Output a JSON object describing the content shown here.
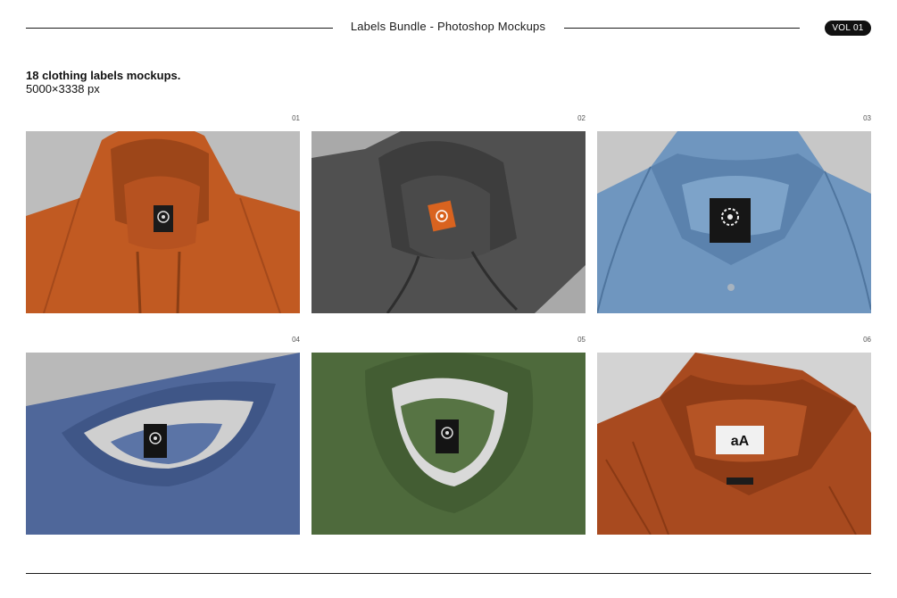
{
  "header": {
    "title": "Labels Bundle - Photoshop Mockups",
    "badge": "VOL 01"
  },
  "intro": {
    "heading": "18 clothing labels mockups.",
    "subheading": "5000×3338 px"
  },
  "mockups": [
    {
      "number": "01",
      "garment": "hoodie",
      "color": "#c15a22",
      "label_color": "#1b1b1b"
    },
    {
      "number": "02",
      "garment": "hoodie",
      "color": "#4a4a4a",
      "label_color": "#d9631f"
    },
    {
      "number": "03",
      "garment": "denim-shirt",
      "color": "#6f96bf",
      "label_color": "#161616"
    },
    {
      "number": "04",
      "garment": "crewneck",
      "color": "#4f679a",
      "label_color": "#141414"
    },
    {
      "number": "05",
      "garment": "crewneck",
      "color": "#4e6a3c",
      "label_color": "#141414"
    },
    {
      "number": "06",
      "garment": "corduroy-shirt",
      "color": "#a84a1f",
      "label_color": "#f1f1f1",
      "label_text": "aA"
    }
  ],
  "icons": {
    "label_logo": "swirl-logo-icon",
    "label_logo_3": "sunburst-logo-icon"
  }
}
